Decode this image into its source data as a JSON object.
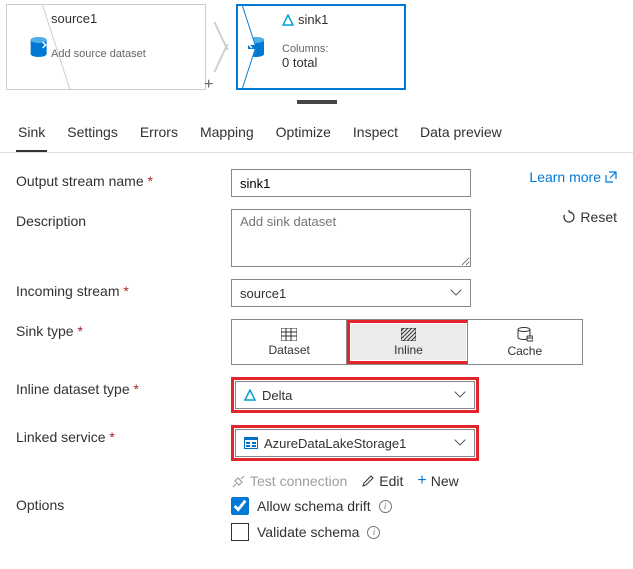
{
  "canvas": {
    "source": {
      "title": "source1",
      "sub": "Add source dataset"
    },
    "sink": {
      "title": "sink1",
      "cols_label": "Columns:",
      "cols_value": "0 total"
    }
  },
  "tabs": [
    "Sink",
    "Settings",
    "Errors",
    "Mapping",
    "Optimize",
    "Inspect",
    "Data preview"
  ],
  "labels": {
    "output_stream": "Output stream name",
    "description": "Description",
    "incoming": "Incoming stream",
    "sink_type": "Sink type",
    "inline_dataset": "Inline dataset type",
    "linked_service": "Linked service",
    "options": "Options",
    "learn_more": "Learn more",
    "reset": "Reset",
    "dataset": "Dataset",
    "inline": "Inline",
    "cache": "Cache",
    "test_connection": "Test connection",
    "edit": "Edit",
    "new": "New",
    "allow_drift": "Allow schema drift",
    "validate_schema": "Validate schema"
  },
  "values": {
    "output_stream": "sink1",
    "description_placeholder": "Add sink dataset",
    "incoming": "source1",
    "inline_dataset": "Delta",
    "linked_service": "AzureDataLakeStorage1"
  }
}
